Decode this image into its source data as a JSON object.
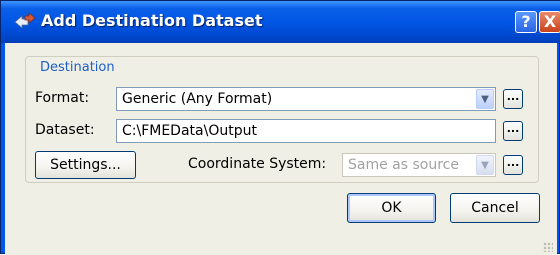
{
  "window": {
    "title": "Add Destination Dataset",
    "help_glyph": "?",
    "close_glyph": "X"
  },
  "destination": {
    "legend": "Destination",
    "format_label": "Format:",
    "format_value": "Generic (Any Format)",
    "dataset_label": "Dataset:",
    "dataset_value": "C:\\FMEData\\Output",
    "settings_label": "Settings...",
    "coord_label": "Coordinate System:",
    "coord_value": "Same as source",
    "browse_label": "..."
  },
  "buttons": {
    "ok": "OK",
    "cancel": "Cancel"
  },
  "icons": {
    "app": "fme-arrows-icon",
    "dropdown": "chevron-down-icon"
  },
  "colors": {
    "title_bar": "#0054e3",
    "dialog_bg": "#f0efe6",
    "legend_text": "#1d5ec8",
    "close_button": "#c8421c"
  }
}
